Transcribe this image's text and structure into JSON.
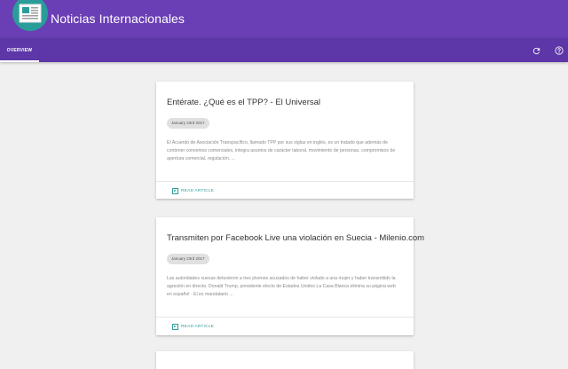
{
  "app": {
    "title": "Noticias Internacionales"
  },
  "tabs": {
    "overview": "OVERVIEW"
  },
  "toolbar": {
    "refresh_icon": "refresh-icon",
    "help_icon": "help-icon"
  },
  "colors": {
    "appbar": "#6a3fb5",
    "tabbar": "#5d36a8",
    "accent": "#2a9d9a",
    "background": "#f0f0f0"
  },
  "articles": [
    {
      "title": "Entérate. ¿Qué es el TPP? - El Universal",
      "date": "January 23rd 2017",
      "snippet": "El Acuerdo de Asociación Transpacífico, llamado TPP por sus siglas en inglés, es un tratado que además de contener convenios comerciales, integra asuntos de carácter laboral, movimiento de personas, compromisos de apertura comercial, regulación, ...",
      "action": "READ ARTICLE"
    },
    {
      "title": "Transmiten por Facebook Live una violación en Suecia - Milenio.com",
      "date": "January 23rd 2017",
      "snippet": "Las autoridades suecas detuvieron a tres jóvenes acusados de haber violado a una mujer y haber transmitido la agresión en directo. Donald Trump, presidente electo de Estados Unidos La Casa Blanca elimina su página web en español · El ex mandatario ...",
      "action": "READ ARTICLE"
    }
  ]
}
